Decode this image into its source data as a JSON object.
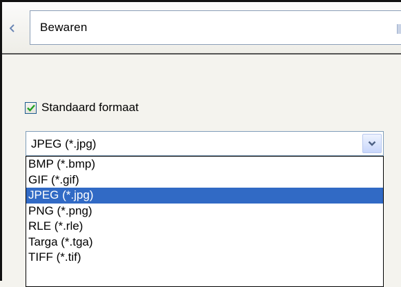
{
  "header": {
    "title": "Bewaren"
  },
  "checkbox": {
    "label": "Standaard formaat",
    "checked": true
  },
  "format_select": {
    "value": "JPEG (*.jpg)",
    "options": [
      "BMP (*.bmp)",
      "GIF (*.gif)",
      "JPEG (*.jpg)",
      "PNG (*.png)",
      "RLE (*.rle)",
      "Targa (*.tga)",
      "TIFF (*.tif)"
    ]
  },
  "colors": {
    "selection": "#316ac5",
    "checkmark": "#21a121",
    "combo_border": "#7f9db9"
  },
  "icons": {
    "nav_left": "chevron-left-icon",
    "combo_button": "chevron-down-icon",
    "checkbox": "checkmark-icon"
  }
}
